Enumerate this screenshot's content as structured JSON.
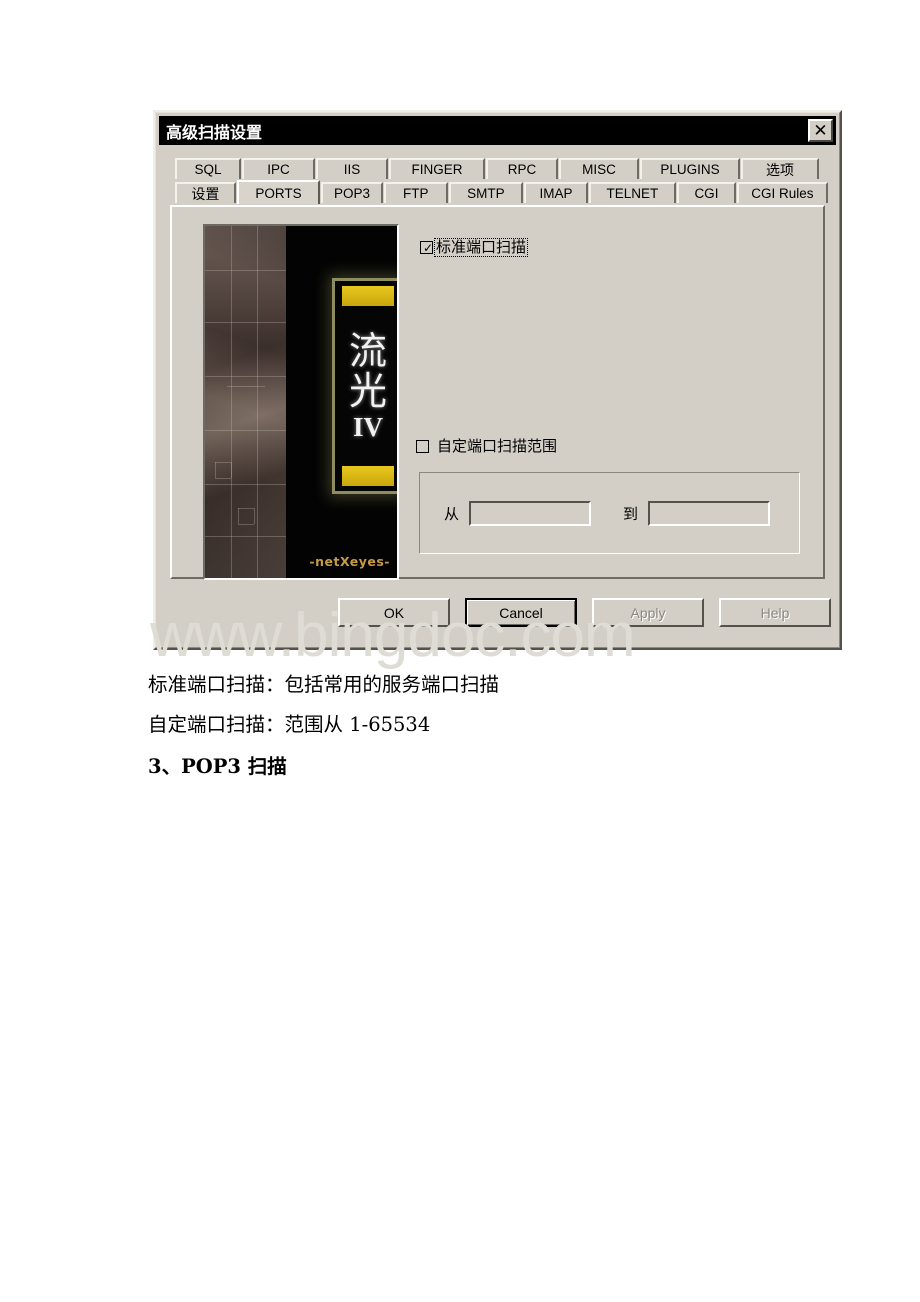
{
  "page": {
    "background": "#ffffff",
    "watermark": "www.bingdoc.com"
  },
  "dialog": {
    "title": "高级扫描设置",
    "close_label": "✕",
    "accent_bg": "#d3cfc7",
    "titlebar_bg": "#000000",
    "tabs": {
      "row1": [
        {
          "label": "SQL",
          "active": false
        },
        {
          "label": "IPC",
          "active": false
        },
        {
          "label": "IIS",
          "active": false
        },
        {
          "label": "FINGER",
          "active": false
        },
        {
          "label": "RPC",
          "active": false
        },
        {
          "label": "MISC",
          "active": false
        },
        {
          "label": "PLUGINS",
          "active": false
        },
        {
          "label": "选项",
          "active": false
        }
      ],
      "row2": [
        {
          "label": "设置",
          "active": false
        },
        {
          "label": "PORTS",
          "active": true
        },
        {
          "label": "POP3",
          "active": false
        },
        {
          "label": "FTP",
          "active": false
        },
        {
          "label": "SMTP",
          "active": false
        },
        {
          "label": "IMAP",
          "active": false
        },
        {
          "label": "TELNET",
          "active": false
        },
        {
          "label": "CGI",
          "active": false
        },
        {
          "label": "CGI Rules",
          "active": false
        }
      ]
    },
    "splash": {
      "char_top": "流",
      "char_bottom": "光",
      "roman": "IV",
      "credit": "-netXeyes-",
      "plate_border": "#8e8d5f",
      "plate_bar": "#e8c81e",
      "credit_color": "#c69b46"
    },
    "ports_page": {
      "standard_scan": {
        "label": "标准端口扫描",
        "checked": true,
        "tick": "✓",
        "focused": true
      },
      "custom_range": {
        "label": "自定端口扫描范围",
        "checked": false,
        "tick": ""
      },
      "from_label": "从",
      "from_value": "",
      "from_placeholder": "",
      "to_label": "到",
      "to_value": "",
      "to_placeholder": ""
    },
    "buttons": [
      {
        "label": "OK",
        "state": "normal"
      },
      {
        "label": "Cancel",
        "state": "default"
      },
      {
        "label": "Apply",
        "state": "disabled"
      },
      {
        "label": "Help",
        "state": "disabled"
      }
    ]
  },
  "document": {
    "line1": "标准端口扫描：包括常用的服务端口扫描",
    "line2": "自定端口扫描：范围从 1-65534",
    "line3": "3、POP3 扫描"
  }
}
